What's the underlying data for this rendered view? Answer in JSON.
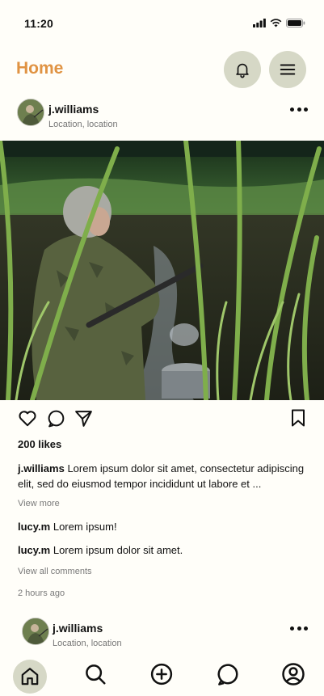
{
  "status": {
    "time": "11:20"
  },
  "header": {
    "title": "Home",
    "title_color": "#e09343",
    "button_bg": "#d6d8c6"
  },
  "posts": [
    {
      "username": "j.williams",
      "location": "Location, location",
      "likes": "200 likes",
      "caption_user": "j.williams",
      "caption_text": "Lorem ipsum dolor sit amet, consectetur adipiscing elit, sed do eiusmod tempor incididunt ut labore et ...",
      "view_more": "View more",
      "comments": [
        {
          "user": "lucy.m",
          "text": "Lorem ipsum!"
        },
        {
          "user": "lucy.m",
          "text": "Lorem ipsum dolor sit amet."
        }
      ],
      "view_all_comments": "View all comments",
      "time_ago": "2 hours ago"
    },
    {
      "username": "j.williams",
      "location": "Location, location"
    }
  ],
  "icons": {
    "bell": "bell-icon",
    "menu": "hamburger-menu-icon",
    "like": "heart-icon",
    "comment": "comment-icon",
    "share": "send-icon",
    "save": "bookmark-icon",
    "nav": [
      "home-icon",
      "search-icon",
      "add-circle-icon",
      "messages-icon",
      "profile-icon"
    ]
  }
}
